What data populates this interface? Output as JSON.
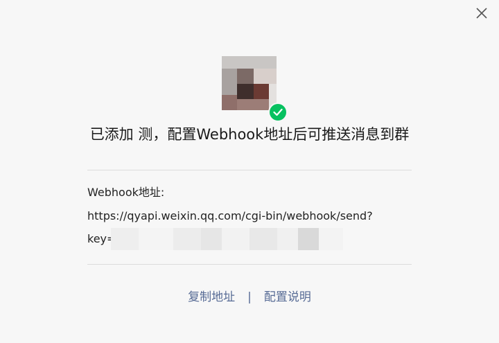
{
  "dialog": {
    "title": "已添加 测，配置Webhook地址后可推送消息到群",
    "webhook_label": "Webhook地址:",
    "webhook_url": "https://qyapi.weixin.qq.com/cgi-bin/webhook/send?",
    "key_prefix": "key=",
    "actions": {
      "copy_label": "复制地址",
      "separator": "|",
      "help_label": "配置说明"
    }
  },
  "icons": {
    "close": "close-icon",
    "check": "check-icon",
    "avatar": "avatar-image"
  },
  "colors": {
    "accent_link": "#576b95",
    "success": "#07c160",
    "background": "#f7f7f7",
    "divider": "#dcdcdc"
  }
}
